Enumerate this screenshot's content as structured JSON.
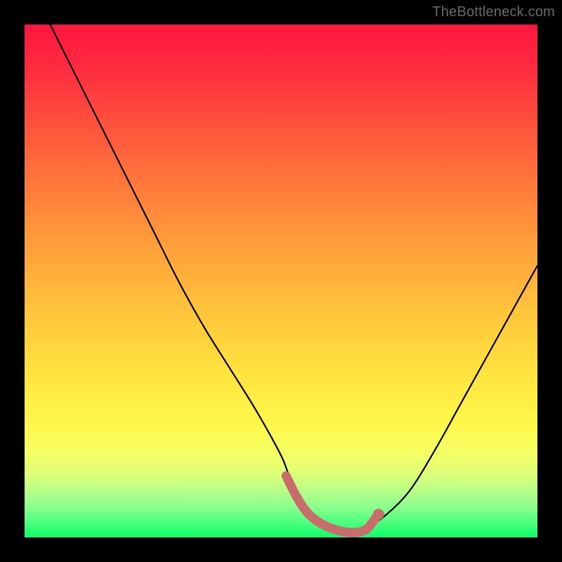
{
  "watermark": "TheBottleneck.com",
  "chart_data": {
    "type": "line",
    "title": "",
    "xlabel": "",
    "ylabel": "",
    "xlim": [
      0,
      100
    ],
    "ylim": [
      0,
      100
    ],
    "grid": false,
    "legend": false,
    "series": [
      {
        "name": "bottleneck-curve",
        "color": "#000000",
        "x": [
          5,
          10,
          15,
          20,
          25,
          30,
          35,
          40,
          45,
          50,
          52,
          55,
          58,
          61,
          63,
          64,
          66,
          70,
          75,
          80,
          85,
          90,
          95,
          100
        ],
        "y": [
          100,
          90,
          80,
          70,
          60,
          50,
          41,
          33,
          25,
          16,
          11,
          6,
          3,
          1.5,
          1,
          1,
          1.5,
          4,
          9,
          17,
          26,
          35,
          44,
          53
        ]
      },
      {
        "name": "optimal-marker",
        "color": "#c96c6c",
        "x": [
          51,
          53,
          55,
          57,
          59,
          61,
          63,
          65,
          66,
          67,
          69
        ],
        "y": [
          12,
          8,
          5,
          3.2,
          2.1,
          1.4,
          1.0,
          1.0,
          1.3,
          1.9,
          4.5
        ]
      }
    ],
    "annotations": []
  }
}
